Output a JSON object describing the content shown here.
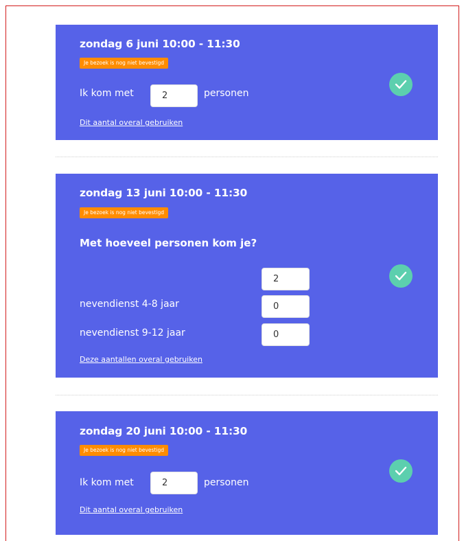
{
  "cards": [
    {
      "date": "zondag 6 juni 10:00 - 11:30",
      "badge": "Je bezoek is nog niet bevestigd",
      "prefix": "Ik kom met",
      "count": "2",
      "suffix": "personen",
      "link": "Dit aantal overal gebruiken"
    },
    {
      "date": "zondag 13 juni 10:00 - 11:30",
      "badge": "Je bezoek is nog niet bevestigd",
      "question": "Met hoeveel personen kom je?",
      "main_count": "2",
      "rows": [
        {
          "label": "nevendienst 4-8 jaar",
          "value": "0"
        },
        {
          "label": "nevendienst 9-12 jaar",
          "value": "0"
        }
      ],
      "link": "Deze aantallen overal gebruiken"
    },
    {
      "date": "zondag 20 juni 10:00 - 11:30",
      "badge": "Je bezoek is nog niet bevestigd",
      "prefix": "Ik kom met",
      "count": "2",
      "suffix": "personen",
      "link": "Dit aantal overal gebruiken"
    }
  ],
  "colors": {
    "card_bg": "#5662e8",
    "badge_bg": "#ff8c00",
    "check_bg": "#5ccfae",
    "frame_border": "#d21b1b"
  },
  "icons": {
    "confirm": "checkmark-circle-icon"
  }
}
